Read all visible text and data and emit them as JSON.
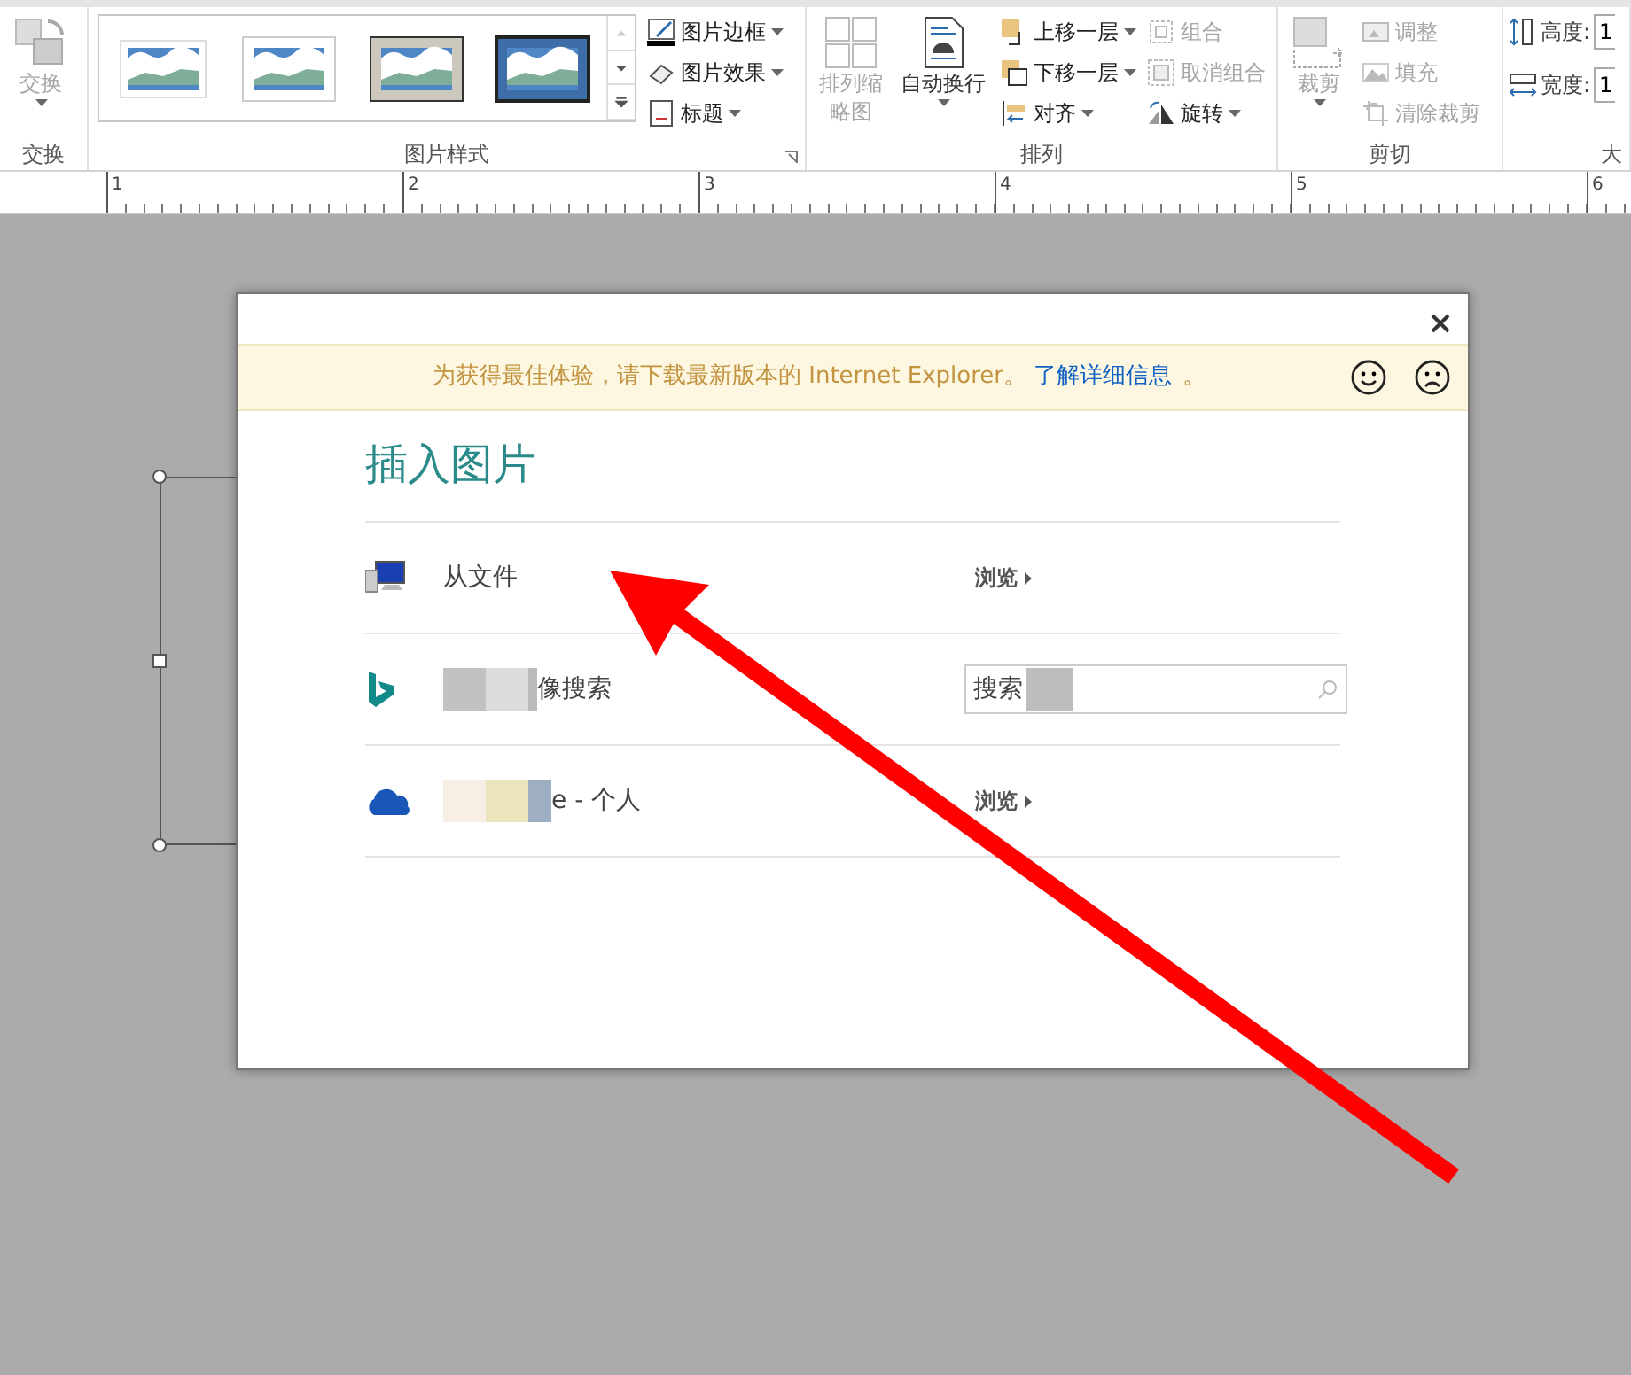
{
  "ribbon": {
    "groups": [
      {
        "label": "交换",
        "big": [
          {
            "label": "交换",
            "kind": "swap",
            "disabled": true,
            "dropdown": true
          }
        ],
        "launcher": false
      },
      {
        "label": "图片样式",
        "gallery": [
          {
            "kind": "soft"
          },
          {
            "kind": "soft-edge"
          },
          {
            "kind": "gray-frame"
          },
          {
            "kind": "dark-frame"
          }
        ],
        "columns": [
          [
            {
              "label": "图片边框",
              "kind": "border",
              "disabled": false,
              "dropdown": true
            },
            {
              "label": "图片效果",
              "kind": "effects",
              "disabled": false,
              "dropdown": true
            },
            {
              "label": "标题",
              "kind": "caption",
              "disabled": false,
              "dropdown": true
            }
          ]
        ],
        "launcher": true
      },
      {
        "label": "排列",
        "big": [
          {
            "label": "排列缩略图",
            "kind": "grid",
            "disabled": true,
            "dropdown": false
          },
          {
            "label": "自动换行",
            "kind": "wrap",
            "disabled": false,
            "dropdown": true
          }
        ],
        "columns": [
          [
            {
              "label": "上移一层",
              "kind": "forward",
              "disabled": false,
              "dropdown": true
            },
            {
              "label": "下移一层",
              "kind": "backward",
              "disabled": false,
              "dropdown": true
            },
            {
              "label": "对齐",
              "kind": "align",
              "disabled": false,
              "dropdown": true
            }
          ],
          [
            {
              "label": "组合",
              "kind": "group",
              "disabled": true,
              "dropdown": false
            },
            {
              "label": "取消组合",
              "kind": "ungroup",
              "disabled": true,
              "dropdown": false
            },
            {
              "label": "旋转",
              "kind": "rotate",
              "disabled": false,
              "dropdown": true
            }
          ]
        ],
        "launcher": false
      },
      {
        "label": "剪切",
        "big": [
          {
            "label": "裁剪",
            "kind": "crop",
            "disabled": true,
            "dropdown": true
          }
        ],
        "columns": [
          [
            {
              "label": "调整",
              "kind": "fit",
              "disabled": true,
              "dropdown": false
            },
            {
              "label": "填充",
              "kind": "fill",
              "disabled": true,
              "dropdown": false
            },
            {
              "label": "清除裁剪",
              "kind": "reset",
              "disabled": true,
              "dropdown": false
            }
          ]
        ],
        "launcher": false
      },
      {
        "label": "大",
        "fields": [
          {
            "label": "高度:",
            "value": "1",
            "kind": "height"
          },
          {
            "label": "宽度:",
            "value": "1",
            "kind": "width"
          }
        ],
        "launcher": false
      }
    ]
  },
  "ruler": {
    "numbers": [
      "1",
      "2",
      "3",
      "4",
      "5",
      "6"
    ]
  },
  "dialog": {
    "banner": {
      "text": "为获得最佳体验，请下载最新版本的 Internet Explorer。",
      "link": "了解详细信息",
      "tail": "。"
    },
    "title": "插入图片",
    "rows": [
      {
        "kind": "browse",
        "redacted": false,
        "label": "从文件",
        "action": "浏览"
      },
      {
        "kind": "search",
        "redacted": true,
        "label": "像搜索",
        "value": "搜索"
      },
      {
        "kind": "browse",
        "redacted": true,
        "label": "e - 个人",
        "action": "浏览"
      }
    ]
  },
  "annotation": {
    "kind": "arrow"
  }
}
